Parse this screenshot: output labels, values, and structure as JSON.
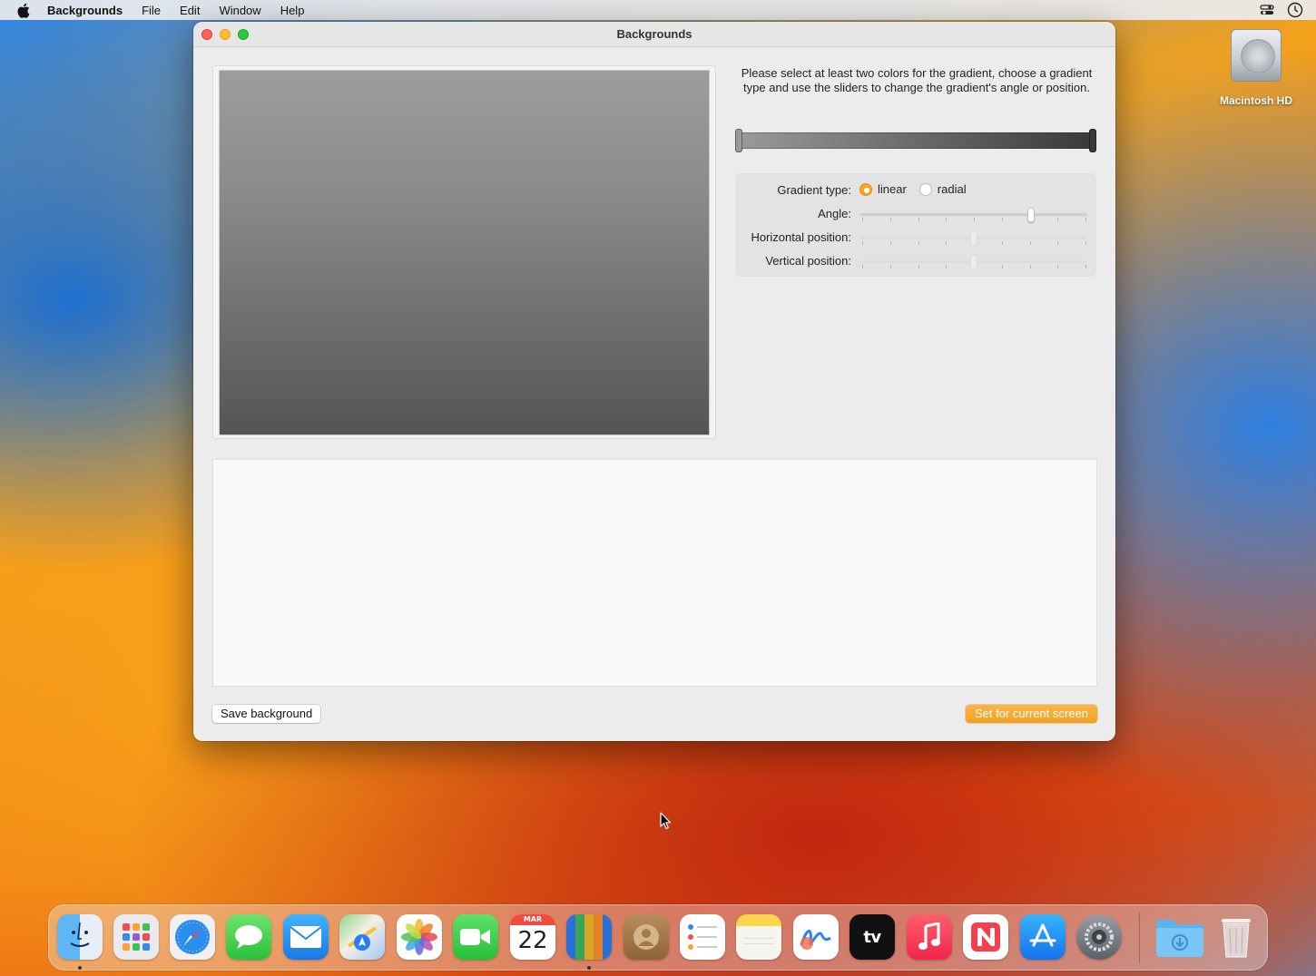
{
  "menubar": {
    "app_name": "Backgrounds",
    "items": [
      "File",
      "Edit",
      "Window",
      "Help"
    ]
  },
  "desktop": {
    "disk_label": "Macintosh HD"
  },
  "window": {
    "title": "Backgrounds",
    "instructions": "Please select at least two colors for the gradient, choose a gradient type and use the sliders to change the gradient's angle or position.",
    "gradient": {
      "start_color": "#9a9a9a",
      "end_color": "#3a3a3a"
    },
    "controls": {
      "gradient_type_label": "Gradient type:",
      "options": [
        "linear",
        "radial"
      ],
      "selected": "linear",
      "angle_label": "Angle:",
      "angle_value": 0.75,
      "horizontal_label": "Horizontal position:",
      "horizontal_value": 0.5,
      "vertical_label": "Vertical position:",
      "vertical_value": 0.5
    },
    "save_button": "Save background",
    "set_button": "Set for current screen",
    "accent_color": "#f5a11f"
  },
  "dock": {
    "icons": [
      "finder-icon",
      "launchpad-icon",
      "safari-icon",
      "messages-icon",
      "mail-icon",
      "maps-icon",
      "photos-icon",
      "facetime-icon",
      "calendar-icon",
      "backgrounds-app-icon",
      "contacts-icon",
      "reminders-icon",
      "notes-icon",
      "freeform-icon",
      "apple-tv-icon",
      "music-icon",
      "news-icon",
      "app-store-icon",
      "system-settings-icon",
      "downloads-folder-icon",
      "trash-icon"
    ],
    "calendar_month": "MAR",
    "calendar_day": "22",
    "tv_label": "tv"
  }
}
